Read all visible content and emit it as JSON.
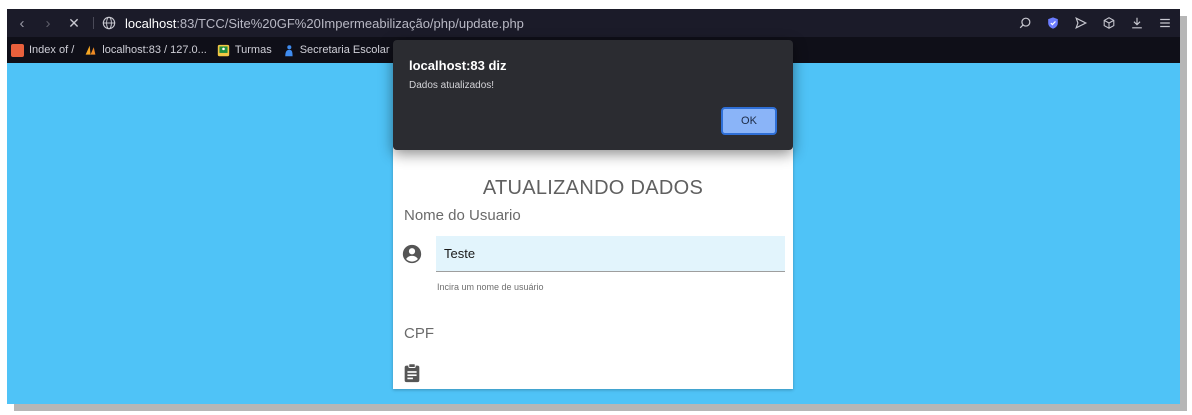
{
  "browser": {
    "url_host": "localhost",
    "url_path": ":83/TCC/Site%20GF%20Impermeabilização/php/update.php",
    "bookmarks": [
      {
        "label": "Index of /",
        "color": "#e8603c"
      },
      {
        "label": "localhost:83 / 127.0...",
        "color": "#f5a623"
      },
      {
        "label": "Turmas",
        "color": "#f2c744"
      },
      {
        "label": "Secretaria Escolar",
        "color": "#3f8cf0"
      }
    ]
  },
  "dialog": {
    "title": "localhost:83 diz",
    "message": "Dados atualizados!",
    "ok_label": "OK"
  },
  "form": {
    "title": "ATUALIZANDO DADOS",
    "username": {
      "label": "Nome do Usuario",
      "value": "Teste",
      "helper": "Incira um nome de usuário"
    },
    "cpf": {
      "label": "CPF"
    }
  },
  "colors": {
    "page_background": "#4fc3f7",
    "dialog_background": "#2b2c31",
    "ok_button": "#8ab4f8"
  }
}
